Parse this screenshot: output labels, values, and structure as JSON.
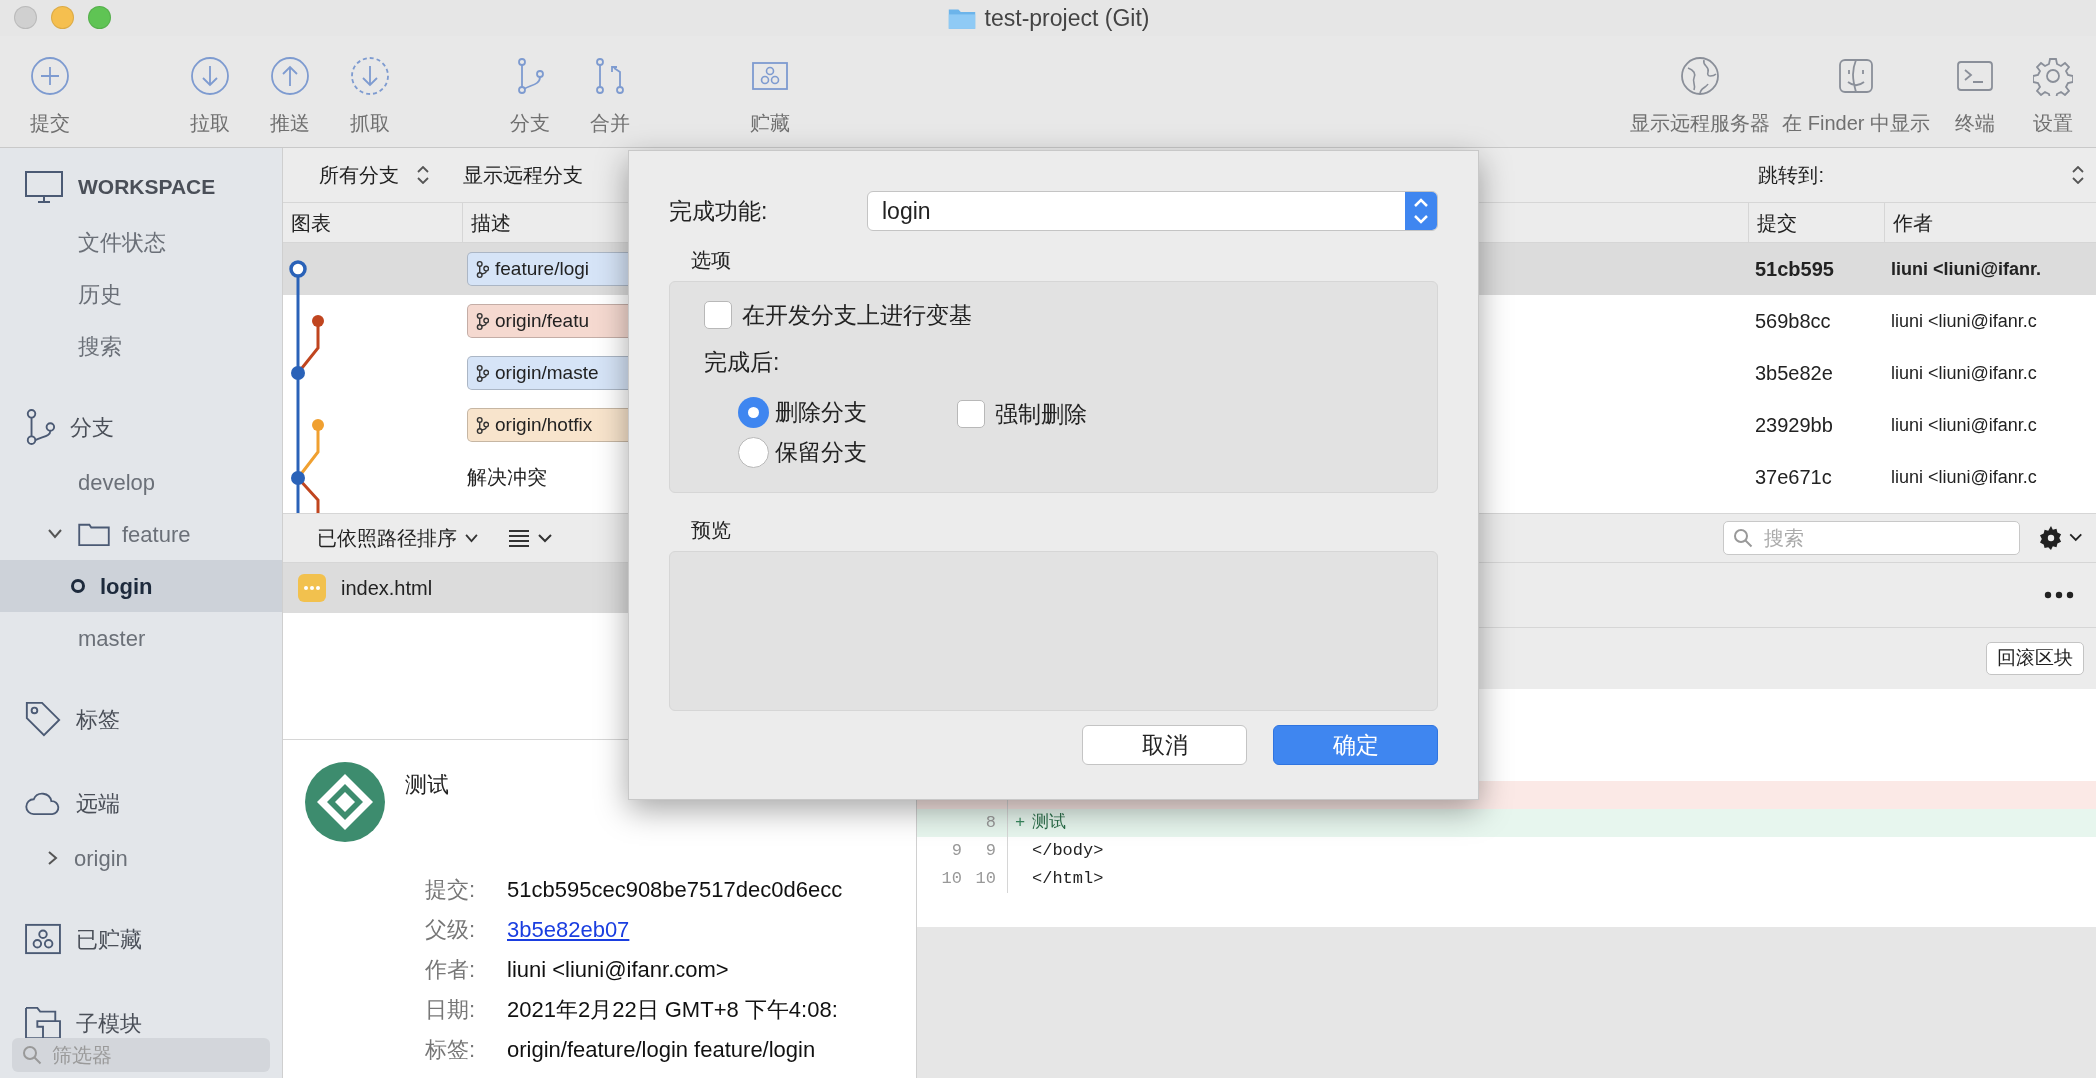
{
  "window": {
    "title": "test-project (Git)"
  },
  "toolbar": {
    "groups": [
      {
        "items": [
          {
            "label": "提交"
          }
        ]
      },
      {
        "items": [
          {
            "label": "拉取"
          },
          {
            "label": "推送"
          },
          {
            "label": "抓取"
          }
        ]
      },
      {
        "items": [
          {
            "label": "分支"
          },
          {
            "label": "合并"
          }
        ]
      },
      {
        "items": [
          {
            "label": "贮藏"
          }
        ]
      }
    ],
    "right": [
      {
        "label": "显示远程服务器"
      },
      {
        "label": "在 Finder 中显示"
      },
      {
        "label": "终端"
      },
      {
        "label": "设置"
      }
    ]
  },
  "sidebar": {
    "sections": [
      {
        "title": "WORKSPACE",
        "items": [
          {
            "label": "文件状态",
            "selected": false
          },
          {
            "label": "历史",
            "selected": false
          },
          {
            "label": "搜索",
            "selected": false
          }
        ]
      },
      {
        "title": "分支",
        "items": [
          {
            "label": "develop",
            "selected": false,
            "current": false
          },
          {
            "label": "feature",
            "selected": false,
            "expanded": true,
            "children": [
              {
                "label": "login",
                "selected": true,
                "current": true
              }
            ]
          },
          {
            "label": "master",
            "selected": false,
            "current": false
          }
        ]
      },
      {
        "title": "标签"
      },
      {
        "title": "远端",
        "items": [
          {
            "label": "origin",
            "selected": false,
            "expanded": false
          }
        ]
      },
      {
        "title": "已贮藏"
      },
      {
        "title": "子模块"
      }
    ],
    "filter": {
      "placeholder": "筛选器"
    }
  },
  "branch_bar": {
    "branches": "所有分支",
    "remote": "显示远程分支",
    "jump": "跳转到:"
  },
  "commits": {
    "columns": [
      "图表",
      "描述",
      "提交",
      "作者"
    ],
    "rows": [
      {
        "refs": [
          {
            "label": "feature/logi",
            "color": "#d6e4f7"
          }
        ],
        "commit": "51cb595",
        "author": "liuni <liuni@ifanr.",
        "selected": true
      },
      {
        "refs": [
          {
            "label": "origin/featu",
            "color": "#f5d9d0"
          }
        ],
        "commit": "569b8cc",
        "author": "liuni <liuni@ifanr.c",
        "selected": false
      },
      {
        "refs": [
          {
            "label": "origin/maste",
            "color": "#d6e4f7"
          }
        ],
        "commit": "3b5e82e",
        "author": "liuni <liuni@ifanr.c",
        "selected": false
      },
      {
        "refs": [
          {
            "label": "origin/hotfix",
            "color": "#f8e4cc"
          }
        ],
        "commit": "23929bb",
        "author": "liuni <liuni@ifanr.c",
        "selected": false
      },
      {
        "description": "解决冲突",
        "commit": "37e671c",
        "author": "liuni <liuni@ifanr.c",
        "selected": false
      }
    ]
  },
  "files": {
    "sort": "已依照路径排序",
    "items": [
      {
        "name": "index.html",
        "selected": true
      }
    ]
  },
  "search": {
    "placeholder": "搜索"
  },
  "details": {
    "message": "测试",
    "fields": [
      {
        "label": "提交:",
        "value": "51cb595cec908be7517dec0d6ecc",
        "link": false
      },
      {
        "label": "父级:",
        "value": "3b5e82eb07",
        "link": true
      },
      {
        "label": "作者:",
        "value": "liuni <liuni@ifanr.com>",
        "link": false
      },
      {
        "label": "日期:",
        "value": "2021年2月22日 GMT+8 下午4:08:",
        "link": false
      },
      {
        "label": "标签:",
        "value": "origin/feature/login feature/login",
        "link": false
      }
    ]
  },
  "diff": {
    "revert_button": "回滚区块",
    "lines": [
      {
        "kind": "removed"
      },
      {
        "kind": "added",
        "new": "8",
        "sign": "+",
        "text": "测试"
      },
      {
        "kind": "context",
        "old": "9",
        "new": "9",
        "text": "</body>"
      },
      {
        "kind": "context",
        "old": "10",
        "new": "10",
        "text": "</html>"
      }
    ]
  },
  "dialog": {
    "feature_label": "完成功能:",
    "feature_value": "login",
    "options_title": "选项",
    "rebase": {
      "label": "在开发分支上进行变基",
      "checked": false
    },
    "after_label": "完成后:",
    "after_choices": [
      {
        "label": "删除分支",
        "selected": true
      },
      {
        "label": "保留分支",
        "selected": false
      }
    ],
    "force_delete": {
      "label": "强制删除",
      "checked": false
    },
    "preview_title": "预览",
    "buttons": [
      {
        "label": "取消",
        "kind": "secondary"
      },
      {
        "label": "确定",
        "kind": "primary"
      }
    ]
  }
}
